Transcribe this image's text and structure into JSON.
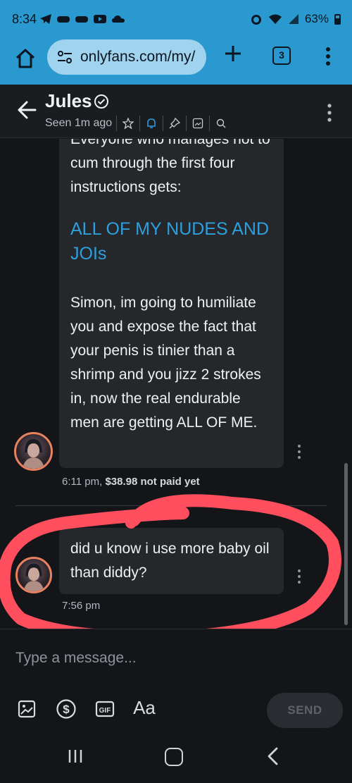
{
  "status_bar": {
    "time": "8:34",
    "battery": "63%",
    "battery_level": 0.63
  },
  "browser": {
    "url": "onlyfans.com/my/",
    "tab_count": "3"
  },
  "chat_header": {
    "name": "Jules",
    "seen": "Seen 1m ago"
  },
  "messages": [
    {
      "lines_p1": "Everyone who manages not to cum through the first four instructions gets:",
      "caps": "ALL OF MY NUDES AND JOIs",
      "lines_p3": "Simon, im going to humiliate you and expose the fact that your penis is tinier than a shrimp and you jizz 2 strokes in, now the real endurable men are getting ALL OF ME.",
      "time": "6:11 pm,",
      "price": "$38.98 not paid yet"
    },
    {
      "text": "did u know i use more baby oil than diddy?",
      "time": "7:56 pm"
    }
  ],
  "composer": {
    "placeholder": "Type a message...",
    "aa_label": "Aa",
    "send_label": "SEND"
  },
  "colors": {
    "accent": "#2a99cf",
    "link_blue": "#2d9fdd",
    "annotation_red": "#ff4f5e",
    "avatar_ring": "#e8815f"
  }
}
